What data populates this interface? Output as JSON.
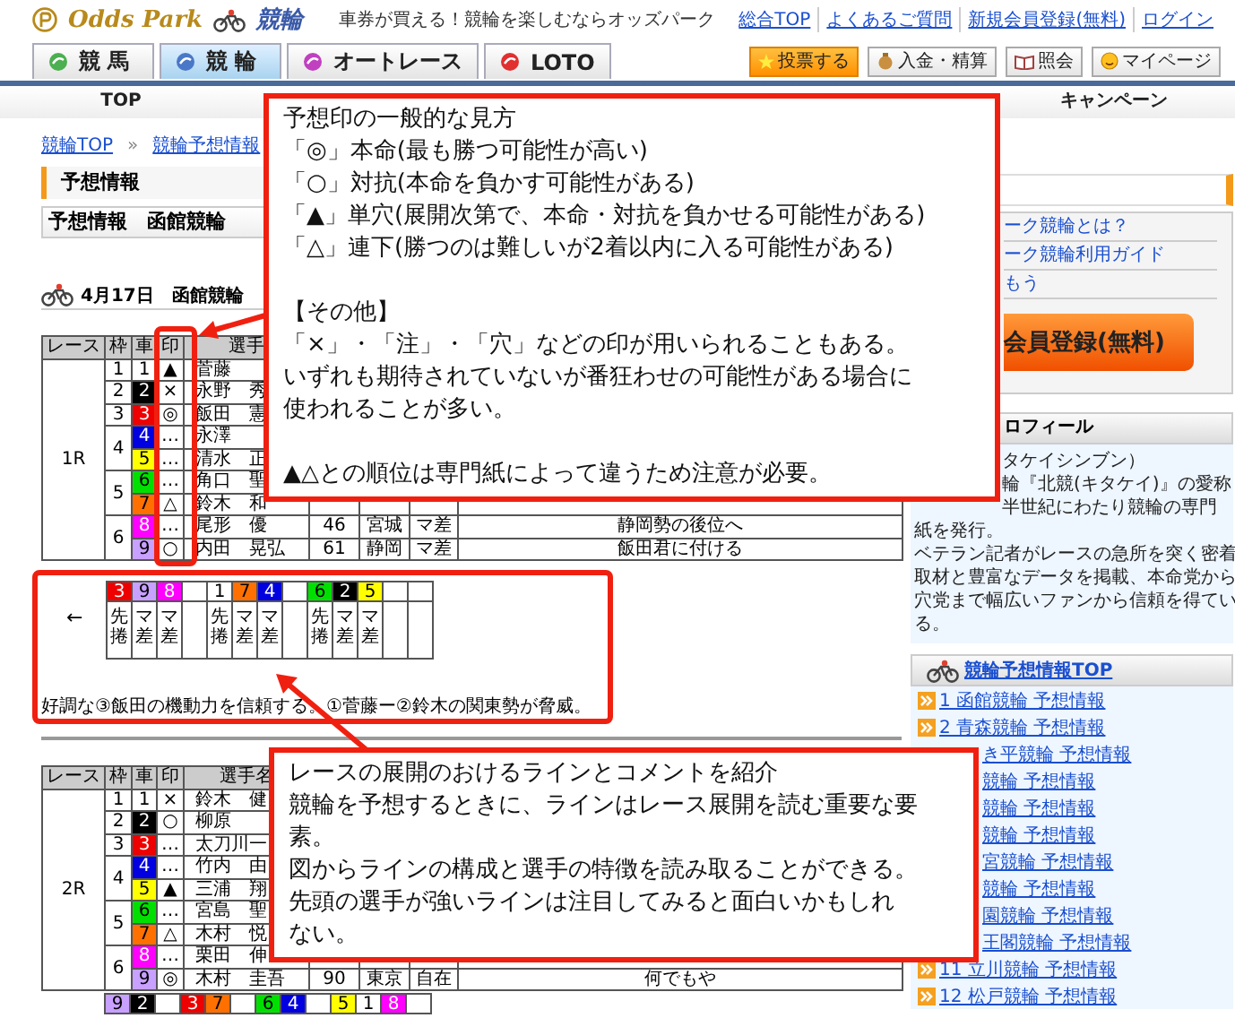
{
  "header": {
    "brand": "Odds Park",
    "brand_sub": "競輪",
    "tagline": "車券が買える！競輪を楽しむならオッズパーク",
    "links": [
      "総合TOP",
      "よくあるご質問",
      "新規会員登録(無料)",
      "ログイン"
    ]
  },
  "tabs": [
    {
      "label": "競 馬",
      "selected": false,
      "color": "#4caf50"
    },
    {
      "label": "競 輪",
      "selected": true,
      "color": "#4a78c8"
    },
    {
      "label": "オートレース",
      "selected": false,
      "color": "#c040c0"
    },
    {
      "label": "LOTO",
      "selected": false,
      "color": "#e03030"
    }
  ],
  "actions": [
    {
      "label": "投票する",
      "kind": "primary"
    },
    {
      "label": "入金・精算",
      "kind": "money"
    },
    {
      "label": "照会",
      "kind": "book"
    },
    {
      "label": "マイページ",
      "kind": "face"
    }
  ],
  "nav": [
    "TOP",
    "キャンペーン"
  ],
  "breadcrumb": {
    "items": [
      "競輪TOP",
      "競輪予想情報"
    ],
    "separator": "»"
  },
  "section_title": "予想情報",
  "subtitle": "予想情報　函館競輪",
  "date_heading": "4月17日　函館競輪",
  "races": [
    {
      "race": "1R",
      "columns": [
        "レース",
        "枠",
        "車",
        "印",
        "選手"
      ],
      "frames": [
        {
          "frame": "1",
          "riders": [
            {
              "car": "1",
              "color": "#ffffff",
              "mark": "▲",
              "name": "菅藤"
            }
          ]
        },
        {
          "frame": "2",
          "riders": [
            {
              "car": "2",
              "color": "#000000",
              "mark": "×",
              "name": "永野　秀"
            }
          ]
        },
        {
          "frame": "3",
          "riders": [
            {
              "car": "3",
              "color": "#ee0000",
              "mark": "◎",
              "name": "飯田　憲"
            }
          ]
        },
        {
          "frame": "4",
          "riders": [
            {
              "car": "4",
              "color": "#0000e0",
              "mark": "…",
              "name": "永澤"
            },
            {
              "car": "5",
              "color": "#ffff00",
              "mark": "…",
              "name": "清水　正"
            }
          ]
        },
        {
          "frame": "5",
          "riders": [
            {
              "car": "6",
              "color": "#00e000",
              "mark": "…",
              "name": "角口　聖"
            },
            {
              "car": "7",
              "color": "#ff7000",
              "mark": "△",
              "name": "鈴木　和"
            }
          ]
        },
        {
          "frame": "6",
          "riders": [
            {
              "car": "8",
              "color": "#ff00ff",
              "mark": "…",
              "name": "尾形　優",
              "age": "46",
              "pref": "宮城",
              "style": "マ差",
              "comment": "静岡勢の後位へ"
            },
            {
              "car": "9",
              "color": "#c8a0ff",
              "mark": "○",
              "name": "内田　晃弘",
              "age": "61",
              "pref": "静岡",
              "style": "マ差",
              "comment": "飯田君に付ける"
            }
          ]
        }
      ]
    },
    {
      "race": "2R",
      "columns": [
        "レース",
        "枠",
        "車",
        "印",
        "選手名"
      ],
      "frames": [
        {
          "frame": "1",
          "riders": [
            {
              "car": "1",
              "color": "#ffffff",
              "mark": "×",
              "name": "鈴木　健"
            }
          ]
        },
        {
          "frame": "2",
          "riders": [
            {
              "car": "2",
              "color": "#000000",
              "mark": "○",
              "name": "柳原"
            }
          ]
        },
        {
          "frame": "3",
          "riders": [
            {
              "car": "3",
              "color": "#ee0000",
              "mark": "…",
              "name": "太刀川一"
            }
          ]
        },
        {
          "frame": "4",
          "riders": [
            {
              "car": "4",
              "color": "#0000e0",
              "mark": "…",
              "name": "竹内　由"
            },
            {
              "car": "5",
              "color": "#ffff00",
              "mark": "▲",
              "name": "三浦　翔"
            }
          ]
        },
        {
          "frame": "5",
          "riders": [
            {
              "car": "6",
              "color": "#00e000",
              "mark": "…",
              "name": "宮島　聖"
            },
            {
              "car": "7",
              "color": "#ff7000",
              "mark": "△",
              "name": "木村　悦"
            }
          ]
        },
        {
          "frame": "6",
          "riders": [
            {
              "car": "8",
              "color": "#ff00ff",
              "mark": "…",
              "name": "栗田　伸"
            },
            {
              "car": "9",
              "color": "#c8a0ff",
              "mark": "◎",
              "name": "木村　圭吾",
              "age": "90",
              "pref": "東京",
              "style": "自在",
              "comment": "何でもや"
            }
          ]
        }
      ]
    }
  ],
  "line_forecast": {
    "arrow": "←",
    "cells": [
      {
        "kind": "rider",
        "car": "3",
        "color": "#ee0000",
        "style": "先捲"
      },
      {
        "kind": "rider",
        "car": "9",
        "color": "#c8a0ff",
        "style": "マ差"
      },
      {
        "kind": "rider",
        "car": "8",
        "color": "#ff00ff",
        "style": "マ差"
      },
      {
        "kind": "gap"
      },
      {
        "kind": "rider",
        "car": "1",
        "color": "#ffffff",
        "style": "先捲"
      },
      {
        "kind": "rider",
        "car": "7",
        "color": "#ff7000",
        "style": "マ差"
      },
      {
        "kind": "rider",
        "car": "4",
        "color": "#0000e0",
        "style": "マ差"
      },
      {
        "kind": "gap"
      },
      {
        "kind": "rider",
        "car": "6",
        "color": "#00e000",
        "style": "先捲"
      },
      {
        "kind": "rider",
        "car": "2",
        "color": "#000000",
        "style": "マ差"
      },
      {
        "kind": "rider",
        "car": "5",
        "color": "#ffff00",
        "style": "マ差"
      },
      {
        "kind": "gap"
      },
      {
        "kind": "gap"
      }
    ],
    "comment": "好調な③飯田の機動力を信頼する。①菅藤ー②鈴木の関東勢が脅威。"
  },
  "line_forecast_next": {
    "cells": [
      {
        "kind": "rider",
        "car": "9",
        "color": "#c8a0ff"
      },
      {
        "kind": "rider",
        "car": "2",
        "color": "#000000"
      },
      {
        "kind": "gap"
      },
      {
        "kind": "rider",
        "car": "3",
        "color": "#ee0000"
      },
      {
        "kind": "rider",
        "car": "7",
        "color": "#ff7000"
      },
      {
        "kind": "gap"
      },
      {
        "kind": "rider",
        "car": "6",
        "color": "#00e000"
      },
      {
        "kind": "rider",
        "car": "4",
        "color": "#0000e0"
      },
      {
        "kind": "gap"
      },
      {
        "kind": "rider",
        "car": "5",
        "color": "#ffff00"
      },
      {
        "kind": "rider",
        "car": "1",
        "color": "#ffffff"
      },
      {
        "kind": "rider",
        "car": "8",
        "color": "#ff00ff"
      },
      {
        "kind": "gap"
      }
    ]
  },
  "sidebar": {
    "campaign_links": [
      "ーク競輪とは？",
      "ーク競輪利用ガイド",
      "もう"
    ],
    "register_button": "会員登録(無料)",
    "profile": {
      "title": "ロフィール",
      "covered_lines": [
        "タケイシンブン）",
        "輪『北競(キタケイ)』の愛称",
        "半世紀にわたり競輪の専門"
      ],
      "lines": [
        "紙を発行。",
        "ベテラン記者がレースの急所を突く密着",
        "取材と豊富なデータを掲載、本命党から",
        "穴党まで幅広いファンから信頼を得てい",
        "る。"
      ]
    },
    "predict_title": "競輪予想情報TOP",
    "predict_links": [
      {
        "label": "1 函館競輪 予想情報",
        "icon": true
      },
      {
        "label": "2 青森競輪 予想情報",
        "icon": true
      },
      {
        "label": "き平競輪 予想情報",
        "icon": false
      },
      {
        "label": "競輪 予想情報",
        "icon": false
      },
      {
        "label": "競輪 予想情報",
        "icon": false
      },
      {
        "label": "競輪 予想情報",
        "icon": false
      },
      {
        "label": "宮競輪 予想情報",
        "icon": false
      },
      {
        "label": "競輪 予想情報",
        "icon": false
      },
      {
        "label": "園競輪 予想情報",
        "icon": false
      },
      {
        "label": "王閣競輪 予想情報",
        "icon": false
      },
      {
        "label": "11 立川競輪 予想情報",
        "icon": true
      },
      {
        "label": "12 松戸競輪 予想情報",
        "icon": true
      }
    ]
  },
  "notes": [
    {
      "paragraphs": [
        [
          "予想印の一般的な見方",
          "「◎」本命(最も勝つ可能性が高い)",
          "「○」対抗(本命を負かす可能性がある)",
          "「▲」単穴(展開次第で、本命・対抗を負かせる可能性がある)",
          "「△」連下(勝つのは難しいが2着以内に入る可能性がある)"
        ],
        [
          "【その他】",
          "「×」・「注」・「穴」などの印が用いられることもある。",
          "いずれも期待されていないが番狂わせの可能性がある場合に",
          "使われることが多い。"
        ],
        [
          "▲△との順位は専門紙によって違うため注意が必要。"
        ]
      ]
    },
    {
      "paragraphs": [
        [
          "レースの展開のおけるラインとコメントを紹介",
          "競輪を予想するときに、ラインはレース展開を読む重要な要",
          "素。",
          "図からラインの構成と選手の特徴を読み取ることができる。",
          "先頭の選手が強いラインは注目してみると面白いかもしれ",
          "ない。"
        ]
      ]
    }
  ]
}
